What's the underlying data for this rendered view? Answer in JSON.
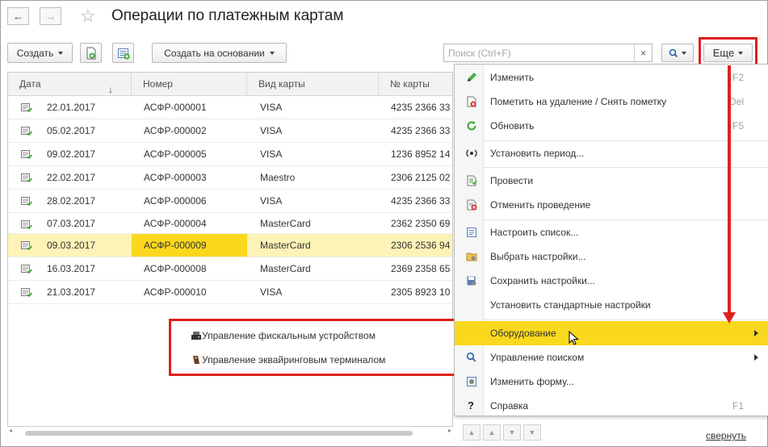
{
  "window": {
    "title": "Операции по платежным картам",
    "nav_back_glyph": "←",
    "nav_forward_glyph": "→",
    "favorite_glyph": "☆"
  },
  "toolbar": {
    "create_label": "Создать",
    "create_based_label": "Создать на основании",
    "search_placeholder": "Поиск (Ctrl+F)",
    "search_value": "",
    "clear_glyph": "×",
    "more_label": "Еще",
    "icons": [
      "copy-add-icon",
      "list-add-icon",
      "magnifier-icon"
    ]
  },
  "table": {
    "columns": [
      "Дата",
      "Номер",
      "Вид карты",
      "№ карты"
    ],
    "sort_glyph": "↓",
    "rows": [
      {
        "date": "22.01.2017",
        "number": "АСФР-000001",
        "card_type": "VISA",
        "card_no": "4235 2366 33"
      },
      {
        "date": "05.02.2017",
        "number": "АСФР-000002",
        "card_type": "VISA",
        "card_no": "4235 2366 33"
      },
      {
        "date": "09.02.2017",
        "number": "АСФР-000005",
        "card_type": "VISA",
        "card_no": "1236 8952 14"
      },
      {
        "date": "22.02.2017",
        "number": "АСФР-000003",
        "card_type": "Maestro",
        "card_no": "2306 2125 02"
      },
      {
        "date": "28.02.2017",
        "number": "АСФР-000006",
        "card_type": "VISA",
        "card_no": "4235 2366 33"
      },
      {
        "date": "07.03.2017",
        "number": "АСФР-000004",
        "card_type": "MasterCard",
        "card_no": "2362 2350 69"
      },
      {
        "date": "09.03.2017",
        "number": "АСФР-000009",
        "card_type": "MasterCard",
        "card_no": "2306 2536 94",
        "selected": true
      },
      {
        "date": "16.03.2017",
        "number": "АСФР-000008",
        "card_type": "MasterCard",
        "card_no": "2369 2358 65"
      },
      {
        "date": "21.03.2017",
        "number": "АСФР-000010",
        "card_type": "VISA",
        "card_no": "2305 8923 10"
      }
    ]
  },
  "equipment_submenu": {
    "items": [
      {
        "label": "Управление фискальным устройством",
        "icon": "fiscal-printer-icon"
      },
      {
        "label": "Управление эквайринговым терминалом",
        "icon": "acquiring-terminal-icon"
      }
    ]
  },
  "more_menu": {
    "items": [
      {
        "label": "Изменить",
        "key": "F2",
        "icon": "pencil-icon"
      },
      {
        "label": "Пометить на удаление / Снять пометку",
        "key": "Del",
        "icon": "delete-mark-icon"
      },
      {
        "label": "Обновить",
        "key": "F5",
        "icon": "refresh-icon"
      },
      {
        "label": "Установить период...",
        "key": "",
        "icon": "period-icon"
      },
      {
        "label": "Провести",
        "key": "",
        "icon": "post-icon"
      },
      {
        "label": "Отменить проведение",
        "key": "",
        "icon": "unpost-icon"
      },
      {
        "label": "Настроить список...",
        "key": "",
        "icon": "list-settings-icon"
      },
      {
        "label": "Выбрать настройки...",
        "key": "",
        "icon": "choose-settings-icon"
      },
      {
        "label": "Сохранить настройки...",
        "key": "",
        "icon": "save-settings-icon"
      },
      {
        "label": "Установить стандартные настройки",
        "key": "",
        "icon": ""
      },
      {
        "label": "Оборудование",
        "key": "",
        "icon": "",
        "submenu": true,
        "active": true
      },
      {
        "label": "Управление поиском",
        "key": "",
        "icon": "search-icon",
        "submenu": true
      },
      {
        "label": "Изменить форму...",
        "key": "",
        "icon": "change-form-icon"
      },
      {
        "label": "Справка",
        "key": "F1",
        "icon": "help-icon"
      }
    ]
  },
  "footer": {
    "collapse_label": "свернуть"
  },
  "colors": {
    "accent_yellow": "#fad81e",
    "selected_row": "#fdf3b7",
    "highlight_red": "#e0201e",
    "doc_green": "#3aa535"
  }
}
